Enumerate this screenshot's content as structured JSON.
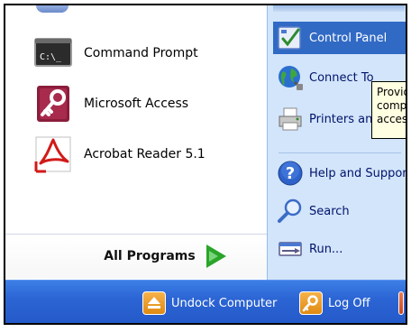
{
  "left_programs": [
    {
      "label": "Command Prompt",
      "icon": "command-prompt-icon"
    },
    {
      "label": "Microsoft Access",
      "icon": "key-icon"
    },
    {
      "label": "Acrobat Reader 5.1",
      "icon": "acrobat-icon"
    }
  ],
  "cmd_icon_text": "C:\\_",
  "all_programs": {
    "label": "All Programs",
    "icon": "green-arrow-icon"
  },
  "right_items": [
    {
      "label": "Control Panel",
      "icon": "control-panel-icon",
      "selected": true
    },
    {
      "label": "Connect To",
      "icon": "globe-icon"
    },
    {
      "label": "Printers and Faxes",
      "icon": "printer-icon"
    },
    {
      "label": "Help and Support",
      "icon": "help-icon"
    },
    {
      "label": "Search",
      "icon": "search-icon"
    },
    {
      "label": "Run...",
      "icon": "run-icon"
    }
  ],
  "tooltip": {
    "lines": [
      "Provides options for you to",
      "complete and customize",
      "access your computer."
    ]
  },
  "bottom_bar": {
    "undock": {
      "label": "Undock Computer",
      "icon": "eject-icon"
    },
    "logoff": {
      "label": "Log Off",
      "icon": "key-icon"
    }
  },
  "colors": {
    "selected": "#316ac5",
    "right_pane_bg": "#d3e5fa",
    "bottom_bar": "#2c65d4",
    "tooltip_bg": "#ffffe1",
    "text_link": "#00136b"
  }
}
